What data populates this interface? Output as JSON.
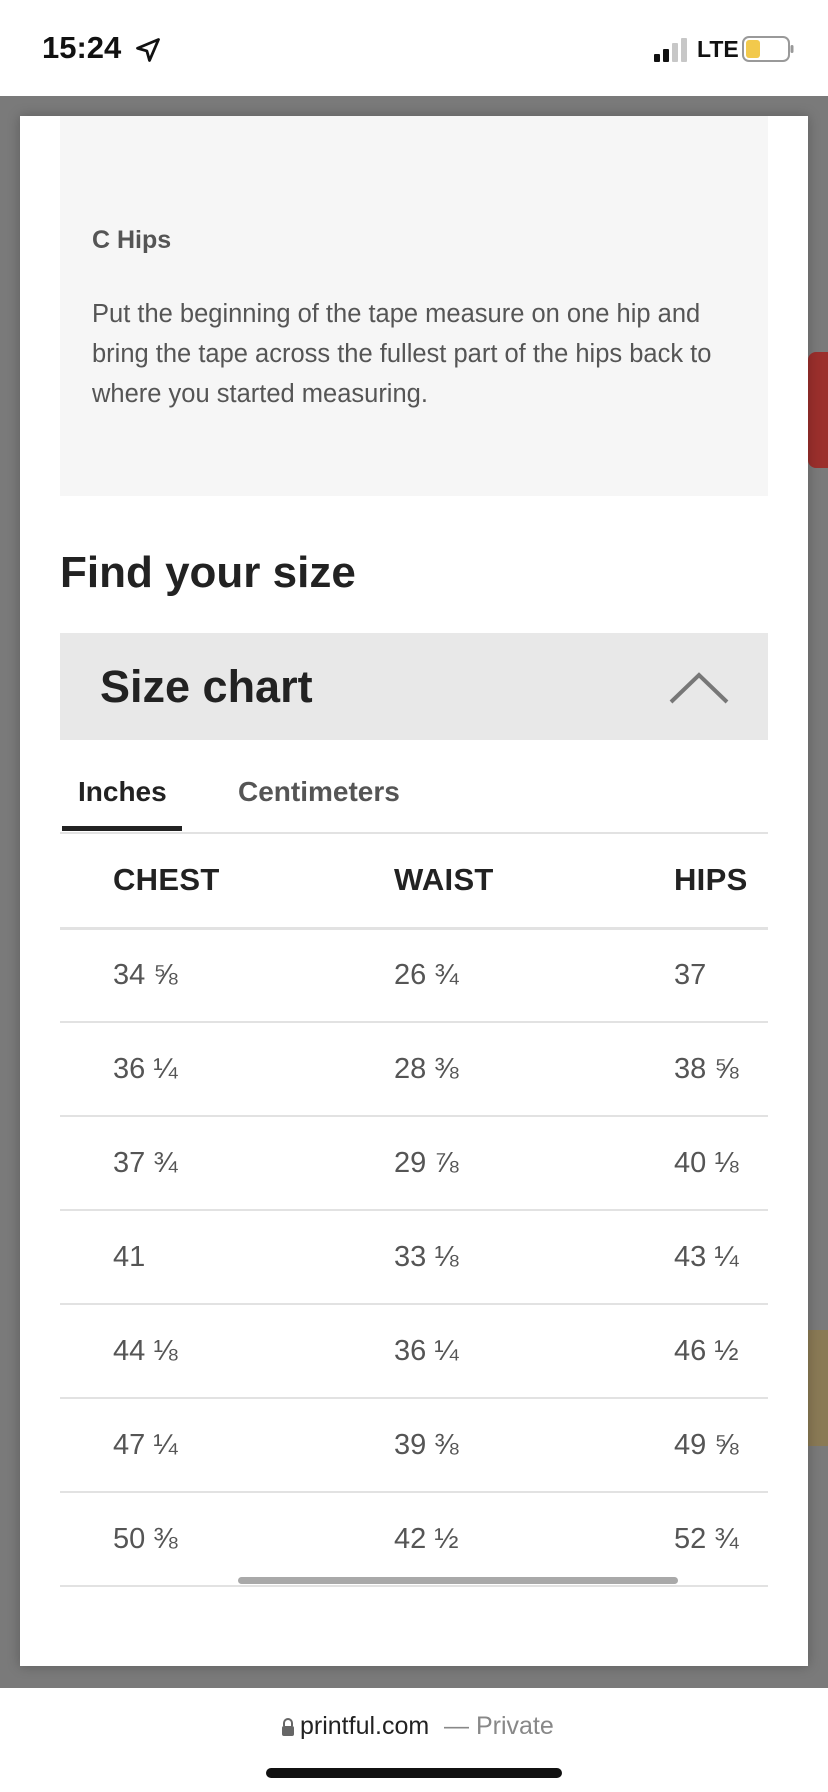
{
  "status": {
    "time": "15:24",
    "network": "LTE"
  },
  "info": {
    "title": "C Hips",
    "text": "Put the beginning of the tape measure on one hip and bring the tape across the fullest part of the hips back to where you started measuring."
  },
  "find_size_heading": "Find your size",
  "size_chart": {
    "title": "Size chart",
    "tabs": [
      {
        "label": "Inches",
        "active": true
      },
      {
        "label": "Centimeters",
        "active": false
      }
    ],
    "columns": [
      "CHEST",
      "WAIST",
      "HIPS"
    ],
    "rows": [
      [
        "34 ⅝",
        "26 ¾",
        "37"
      ],
      [
        "36 ¼",
        "28 ⅜",
        "38 ⅝"
      ],
      [
        "37 ¾",
        "29 ⅞",
        "40 ⅛"
      ],
      [
        "41",
        "33 ⅛",
        "43 ¼"
      ],
      [
        "44 ⅛",
        "36 ¼",
        "46 ½"
      ],
      [
        "47 ¼",
        "39 ⅜",
        "49 ⅝"
      ],
      [
        "50 ⅜",
        "42 ½",
        "52 ¾"
      ]
    ]
  },
  "browser": {
    "domain": "printful.com",
    "privacy": "— Private"
  },
  "colors": {
    "battery_fill": "#f2c94c",
    "tab_header_bg": "#e8e8e8",
    "backdrop": "#7a7a7a"
  }
}
